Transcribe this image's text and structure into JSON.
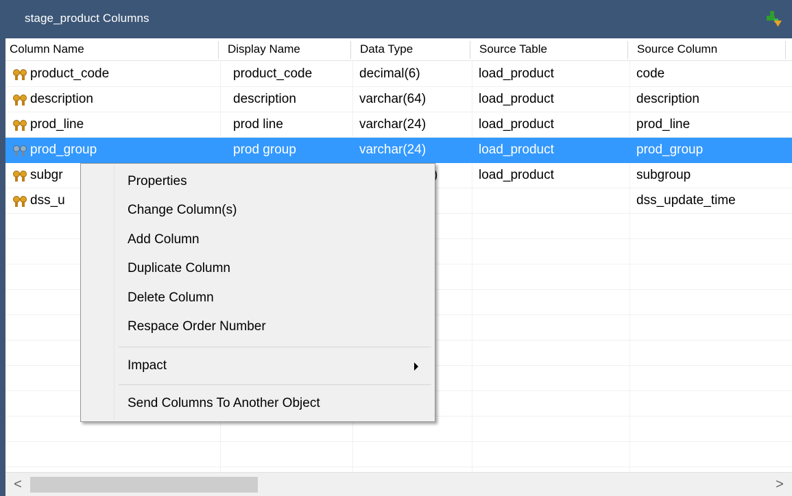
{
  "window": {
    "title": "stage_product Columns",
    "title_icon": "tree-arrow-icon"
  },
  "columns": [
    "Column Name",
    "Display Name",
    "Data Type",
    "Source Table",
    "Source Column"
  ],
  "rows": [
    {
      "column_name": "product_code",
      "display_name": "product_code",
      "data_type": "decimal(6)",
      "source_table": "load_product",
      "source_column": "code"
    },
    {
      "column_name": "description",
      "display_name": "description",
      "data_type": "varchar(64)",
      "source_table": "load_product",
      "source_column": "description"
    },
    {
      "column_name": "prod_line",
      "display_name": "prod line",
      "data_type": "varchar(24)",
      "source_table": "load_product",
      "source_column": "prod_line"
    },
    {
      "column_name": "prod_group",
      "display_name": "prod group",
      "data_type": "varchar(24)",
      "source_table": "load_product",
      "source_column": "prod_group"
    },
    {
      "column_name": "subgr",
      "display_name": "",
      "data_type": ")",
      "source_table": "load_product",
      "source_column": "subgroup"
    },
    {
      "column_name": "dss_u",
      "display_name": "",
      "data_type": "",
      "source_table": "",
      "source_column": "dss_update_time"
    }
  ],
  "selected_row": "prod_group",
  "context_menu": {
    "items": [
      "Properties",
      "Change Column(s)",
      "Add Column",
      "Duplicate Column",
      "Delete Column",
      "Respace Order Number",
      "Impact",
      "Send Columns To Another Object"
    ],
    "submenu_item": "Impact"
  },
  "scrollbar": {
    "left_arrow": "<",
    "right_arrow": ">"
  },
  "colors": {
    "titlebar": "#3c5677",
    "selection": "#3399ff",
    "menu_bg": "#f0f0f0"
  }
}
